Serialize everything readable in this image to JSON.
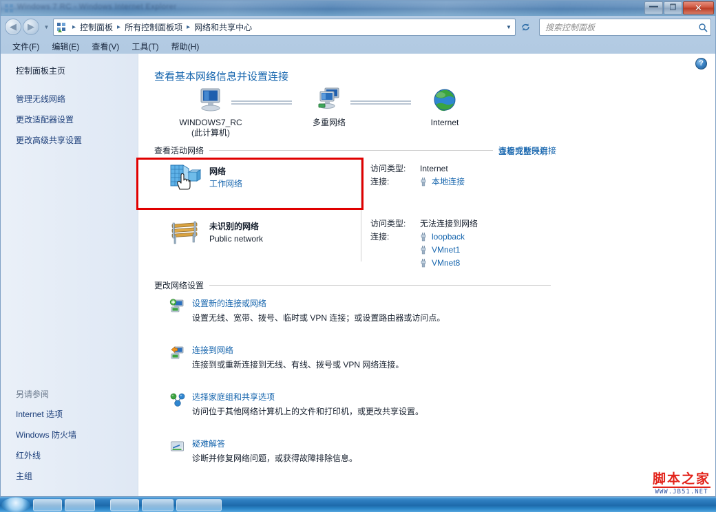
{
  "window": {
    "title_blurred": "Windows 7 RC - Windows Internet Explorer",
    "buttons": {
      "minimize": "—",
      "maximize": "❐",
      "close": "✕"
    }
  },
  "addressbar": {
    "crumbs": [
      "控制面板",
      "所有控制面板项",
      "网络和共享中心"
    ],
    "separator": "▸",
    "dropdown_caret": "▼",
    "refresh_label": "↻",
    "search_placeholder": "搜索控制面板",
    "search_icon": "search-icon",
    "back_icon": "◀",
    "forward_icon": "▶"
  },
  "menubar": {
    "items": [
      "文件(F)",
      "编辑(E)",
      "查看(V)",
      "工具(T)",
      "帮助(H)"
    ]
  },
  "sidebar": {
    "home": "控制面板主页",
    "links": [
      "管理无线网络",
      "更改适配器设置",
      "更改高级共享设置"
    ],
    "see_also_heading": "另请参阅",
    "see_also": [
      "Internet 选项",
      "Windows 防火墙",
      "红外线",
      "主组"
    ]
  },
  "main": {
    "help_icon_label": "?",
    "page_title": "查看基本网络信息并设置连接",
    "netmap": {
      "nodes": [
        {
          "name": "WINDOWS7_RC",
          "sub": "(此计算机)",
          "icon": "computer-icon"
        },
        {
          "name": "多重网络",
          "sub": "",
          "icon": "multiple-networks-icon"
        },
        {
          "name": "Internet",
          "sub": "",
          "icon": "globe-icon"
        }
      ],
      "full_map_link": "查看完整映射"
    },
    "active_networks": {
      "section_title": "查看活动网络",
      "section_action": "连接或断开连接",
      "rows": [
        {
          "icon": "building-network-icon",
          "name": "网络",
          "type": "工作网络",
          "type_is_link": true,
          "access_label": "访问类型:",
          "access_value": "Internet",
          "connections_label": "连接:",
          "connections": [
            "本地连接"
          ],
          "highlighted": true,
          "cursor": "hand-cursor"
        },
        {
          "icon": "bench-icon",
          "name": "未识别的网络",
          "type": "Public network",
          "type_is_link": false,
          "access_label": "访问类型:",
          "access_value": "无法连接到网络",
          "connections_label": "连接:",
          "connections": [
            "loopback",
            "VMnet1",
            "VMnet8"
          ],
          "highlighted": false
        }
      ]
    },
    "change_settings": {
      "section_title": "更改网络设置",
      "items": [
        {
          "icon": "new-connection-icon",
          "title": "设置新的连接或网络",
          "description": "设置无线、宽带、拨号、临时或 VPN 连接；或设置路由器或访问点。"
        },
        {
          "icon": "connect-network-icon",
          "title": "连接到网络",
          "description": "连接到或重新连接到无线、有线、拨号或 VPN 网络连接。"
        },
        {
          "icon": "homegroup-icon",
          "title": "选择家庭组和共享选项",
          "description": "访问位于其他网络计算机上的文件和打印机，或更改共享设置。"
        },
        {
          "icon": "troubleshoot-icon",
          "title": "疑难解答",
          "description": "诊断并修复网络问题，或获得故障排除信息。"
        }
      ]
    }
  },
  "watermark": {
    "text": "脚本之家",
    "url": "WWW.JB51.NET"
  },
  "colors": {
    "link": "#1464ad",
    "title": "#1464ad",
    "highlight_box": "#e00000",
    "watermark_red": "#e2231a",
    "watermark_blue": "#2b4fa0"
  }
}
